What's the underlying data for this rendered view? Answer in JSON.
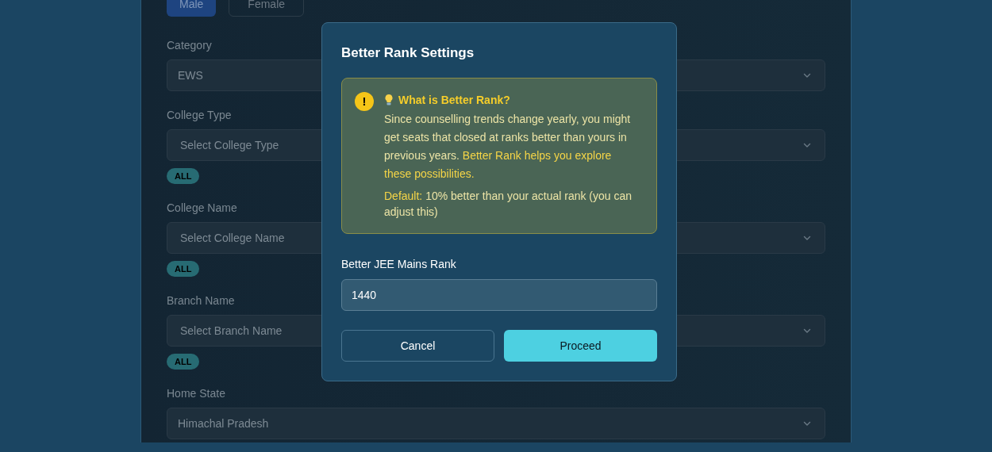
{
  "gender": {
    "options": [
      {
        "label": "Male",
        "selected": true
      },
      {
        "label": "Female",
        "selected": false
      }
    ]
  },
  "fields": [
    {
      "label": "Category",
      "value": "EWS"
    },
    {
      "label": "College Type",
      "placeholder": "Select College Type",
      "badge": "ALL"
    },
    {
      "label": "College Name",
      "placeholder": "Select College Name",
      "badge": "ALL"
    },
    {
      "label": "Branch Name",
      "placeholder": "Select Branch Name",
      "badge": "ALL"
    },
    {
      "label": "Home State",
      "value": "Himachal Pradesh"
    }
  ],
  "dialog": {
    "title": "Better Rank Settings",
    "info": {
      "icon": "!",
      "heading": "What is Better Rank?",
      "text": "Since counselling trends change yearly, you might get seats that closed at ranks better than yours in previous years.",
      "highlight": "Better Rank helps you explore these possibilities.",
      "default_label": "Default:",
      "default_text": "10% better than your actual rank (you can adjust this)"
    },
    "field": {
      "label": "Better JEE Mains Rank",
      "value": "1440"
    },
    "buttons": [
      {
        "label": "Cancel",
        "kind": "secondary"
      },
      {
        "label": "Proceed",
        "kind": "primary"
      }
    ]
  }
}
